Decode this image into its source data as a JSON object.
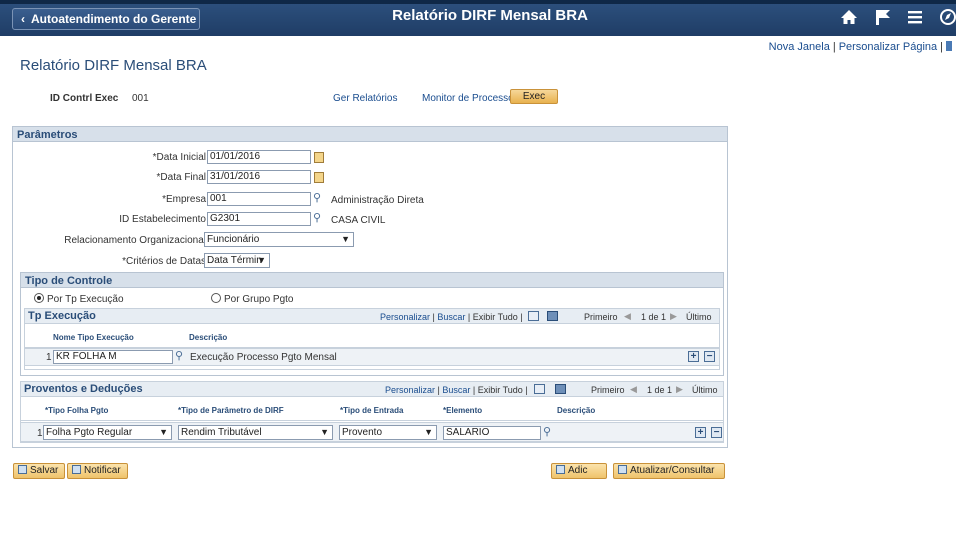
{
  "banner": {
    "back_label": "Autoatendimento do Gerente",
    "title": "Relatório DIRF Mensal BRA",
    "icons": [
      "home-icon",
      "flag-icon",
      "menu-icon",
      "navbar-icon"
    ]
  },
  "top_links": {
    "new_window": "Nova Janela",
    "personalize_page": "Personalizar Página"
  },
  "page_title": "Relatório DIRF Mensal BRA",
  "run_control": {
    "id_label": "ID Contrl Exec",
    "id_value": "001",
    "report_manager": "Ger Relatórios",
    "process_monitor": "Monitor de Processos",
    "exec_label": "Exec"
  },
  "parameters": {
    "header": "Parâmetros",
    "start_date_label": "*Data Inicial",
    "start_date": "01/01/2016",
    "end_date_label": "*Data Final",
    "end_date": "31/01/2016",
    "company_label": "*Empresa",
    "company": "001",
    "company_desc": "Administração Direta",
    "establishment_label": "ID Estabelecimento",
    "establishment": "G2301",
    "establishment_desc": "CASA CIVIL",
    "org_rel_label": "Relacionamento Organizacional",
    "org_rel": "Funcionário",
    "date_criteria_label": "*Critérios de Datas",
    "date_criteria": "Data Términ"
  },
  "control_type": {
    "header": "Tipo de Controle",
    "option_exec": "Por Tp Execução",
    "option_group": "Por Grupo Pgto"
  },
  "tp_exec_grid": {
    "header": "Tp Execução",
    "personalize": "Personalizar",
    "find": "Buscar",
    "view_all": "Exibir Tudo",
    "first": "Primeiro",
    "range": "1 de 1",
    "last": "Último",
    "col_name": "Nome Tipo Execução",
    "col_desc": "Descrição",
    "row_num": "1",
    "row_name": "KR FOLHA M",
    "row_desc": "Execução Processo Pgto Mensal"
  },
  "earnings_grid": {
    "header": "Proventos e Deduções",
    "personalize": "Personalizar",
    "find": "Buscar",
    "view_all": "Exibir Tudo",
    "first": "Primeiro",
    "range": "1 de 1",
    "last": "Último",
    "col_pay_type": "*Tipo Folha Pgto",
    "col_dirf_type": "*Tipo de Parâmetro de DIRF",
    "col_entry_type": "*Tipo de Entrada",
    "col_element": "*Elemento",
    "col_desc": "Descrição",
    "row_num": "1",
    "pay_type": "Folha Pgto Regular",
    "dirf_type": "Rendim Tributável",
    "entry_type": "Provento",
    "element": "SALARIO"
  },
  "buttons": {
    "save": "Salvar",
    "notify": "Notificar",
    "add": "Adic",
    "update": "Atualizar/Consultar"
  }
}
